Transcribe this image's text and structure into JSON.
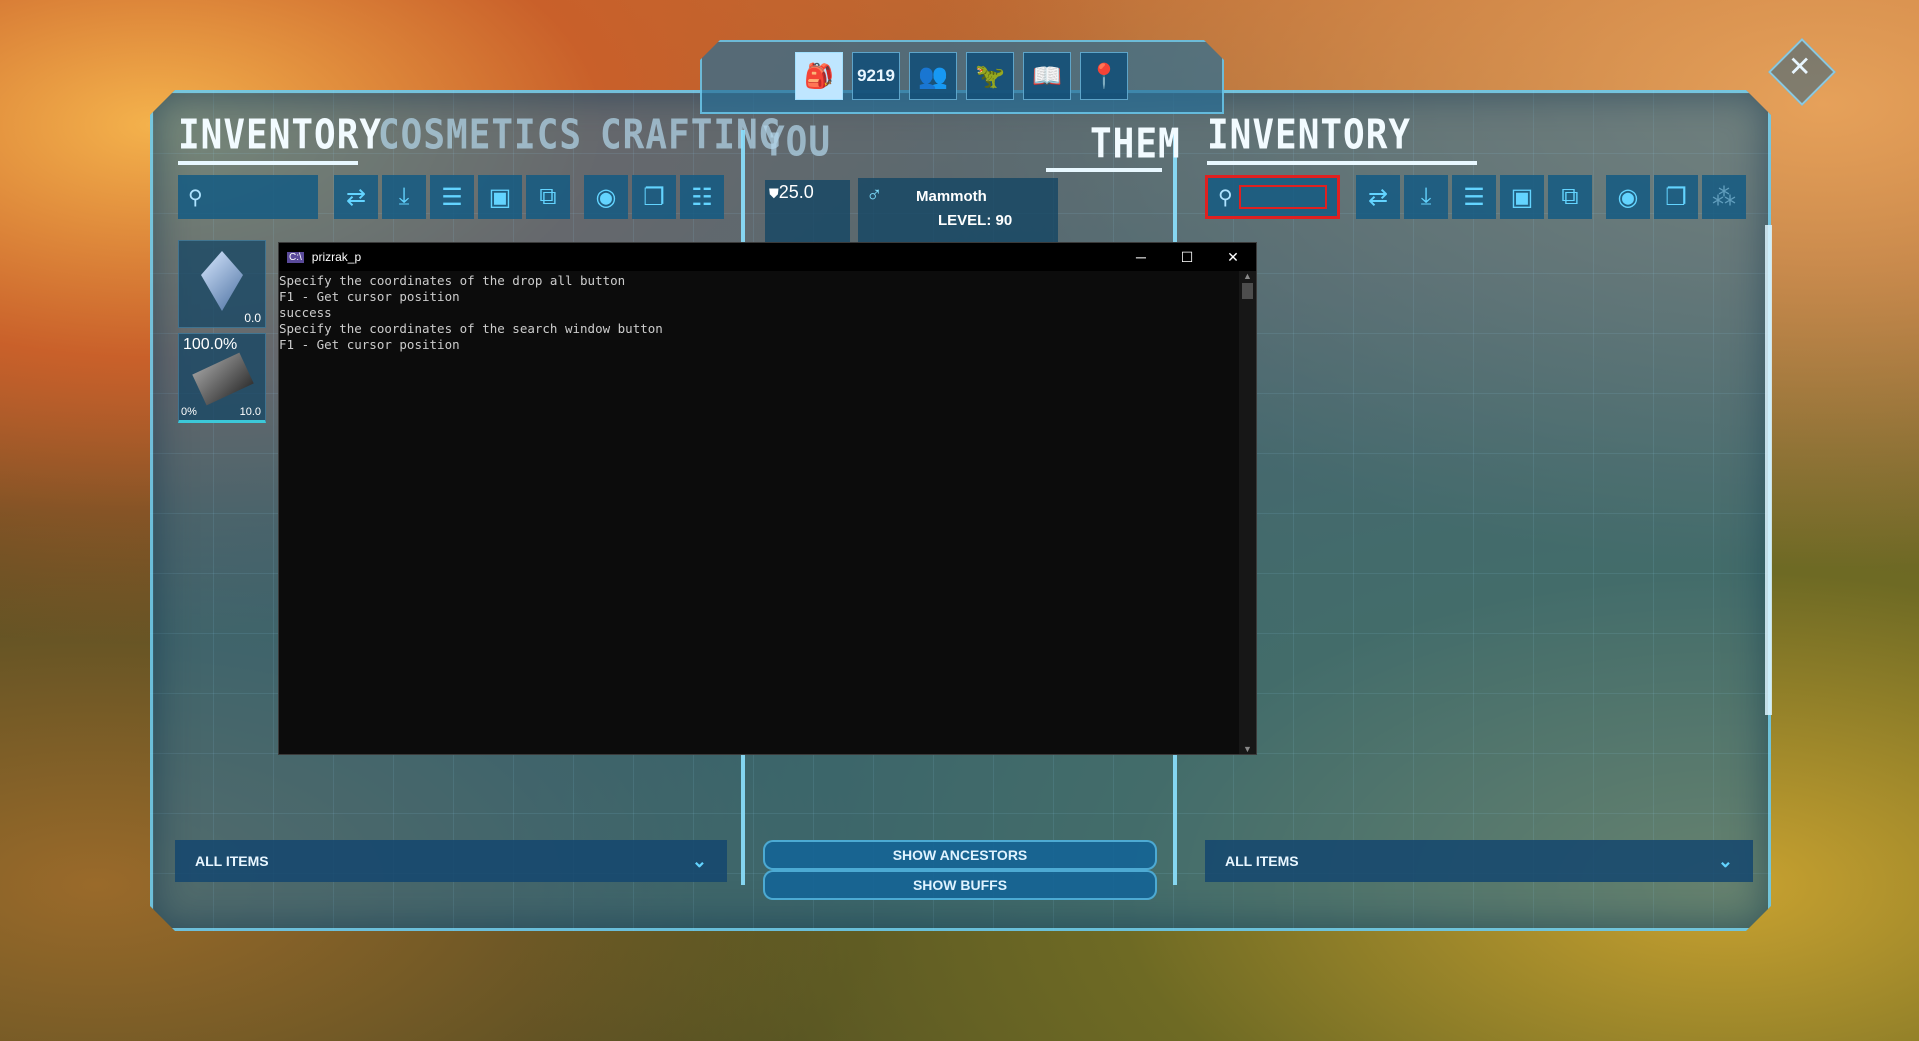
{
  "top_nav": {
    "buttons": [
      {
        "name": "inventory-tab-icon",
        "glyph": "🎒",
        "active": true
      },
      {
        "name": "engrams-icon",
        "label": "9219"
      },
      {
        "name": "tribe-icon",
        "glyph": "👥"
      },
      {
        "name": "tame-icon",
        "glyph": "🦖"
      },
      {
        "name": "explorer-notes-icon",
        "glyph": "📖"
      },
      {
        "name": "map-marker-icon",
        "glyph": "📍"
      }
    ]
  },
  "left": {
    "tabs": [
      "INVENTORY",
      "COSMETICS",
      "CRAFTING"
    ],
    "search_placeholder": "",
    "items": [
      {
        "value": "0.0"
      },
      {
        "durability": "100.0%",
        "pct": "0%",
        "weight": "10.0"
      }
    ],
    "filter": "ALL ITEMS"
  },
  "center": {
    "tab_you": "YOU",
    "tab_them": "THEM",
    "armor": "25.0",
    "creature_name": "Mammoth",
    "creature_level": "LEVEL: 90",
    "show_ancestors": "SHOW ANCESTORS",
    "show_buffs": "SHOW BUFFS"
  },
  "right": {
    "tab": "INVENTORY",
    "filter": "ALL ITEMS"
  },
  "console": {
    "title": "prizrak_p",
    "lines": [
      "Specify the coordinates of the drop all button",
      "F1 - Get cursor position",
      "success",
      "Specify the coordinates of the search window button",
      "F1 - Get cursor position"
    ],
    "minimize": "─",
    "maximize": "☐",
    "close": "✕"
  },
  "colors": {
    "accent": "#63d4ff",
    "highlight_box": "#e02020"
  }
}
